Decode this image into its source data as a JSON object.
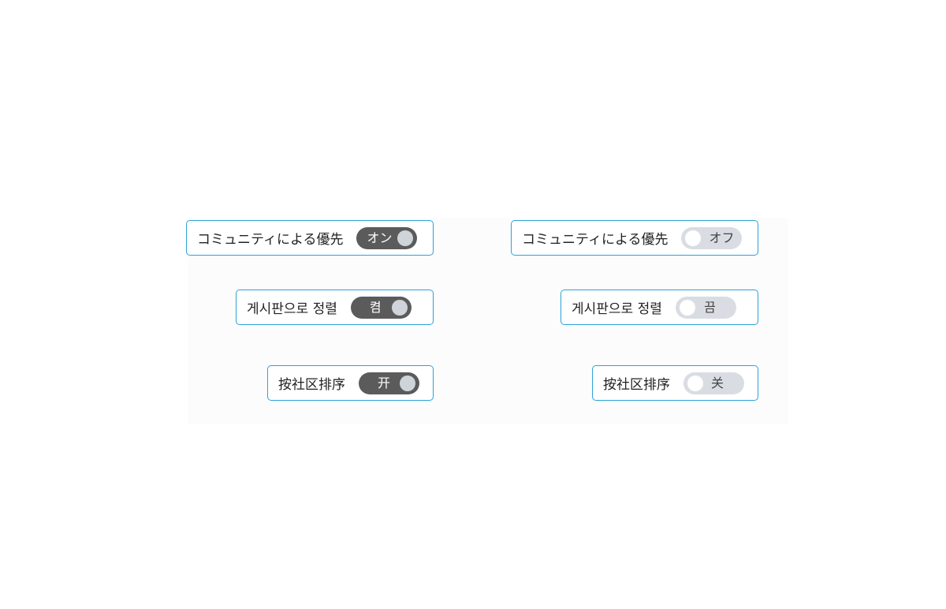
{
  "settings_on": [
    {
      "label": "コミュニティによる優先",
      "state": "オン"
    },
    {
      "label": "게시판으로 정렬",
      "state": "켬"
    },
    {
      "label": "按社区排序",
      "state": "开"
    }
  ],
  "settings_off": [
    {
      "label": "コミュニティによる優先",
      "state": "オフ"
    },
    {
      "label": "게시판으로 정렬",
      "state": "끔"
    },
    {
      "label": "按社区排序",
      "state": "关"
    }
  ],
  "colors": {
    "border": "#2aa3d6",
    "toggle_on": "#5b5b5b",
    "toggle_off": "#d9dde3"
  }
}
